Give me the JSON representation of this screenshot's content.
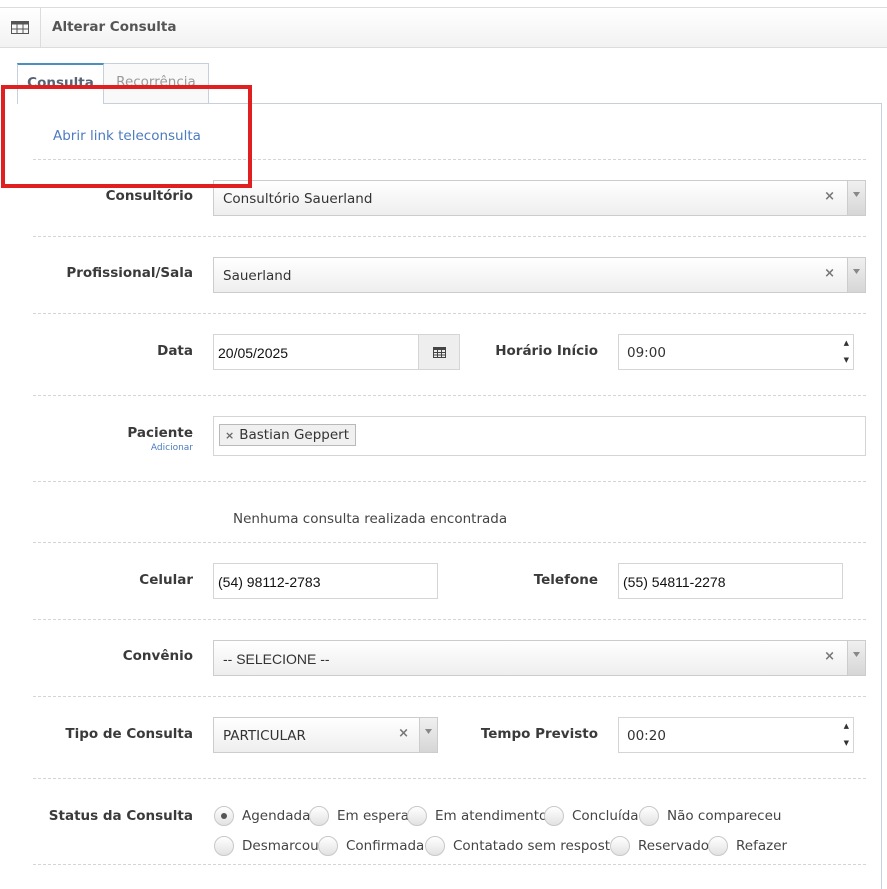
{
  "header": {
    "title": "Alterar Consulta",
    "icon": "table-icon"
  },
  "tabs": [
    {
      "label": "Consulta",
      "active": true
    },
    {
      "label": "Recorrência",
      "active": false
    }
  ],
  "teleconsulta_link": "Abrir link teleconsulta",
  "fields": {
    "consultorio": {
      "label": "Consultório",
      "value": "Consultório Sauerland",
      "clear": "×"
    },
    "profissional": {
      "label": "Profissional/Sala",
      "value": "Sauerland",
      "clear": "×"
    },
    "data": {
      "label": "Data",
      "value": "20/05/2025"
    },
    "horario_inicio": {
      "label": "Horário Início",
      "value": "09:00"
    },
    "paciente": {
      "label": "Paciente",
      "sublabel": "Adicionar",
      "tag": "Bastian Geppert",
      "tag_remove": "×"
    },
    "info_message": "Nenhuma consulta realizada encontrada",
    "celular": {
      "label": "Celular",
      "value": "(54) 98112-2783"
    },
    "telefone": {
      "label": "Telefone",
      "value": "(55) 54811-2278"
    },
    "convenio": {
      "label": "Convênio",
      "value": "-- SELECIONE --",
      "clear": "×"
    },
    "tipo_consulta": {
      "label": "Tipo de Consulta",
      "value": "PARTICULAR",
      "clear": "×"
    },
    "tempo_previsto": {
      "label": "Tempo Previsto",
      "value": "00:20"
    },
    "status": {
      "label": "Status da Consulta",
      "selected": "Agendada",
      "options": [
        "Agendada",
        "Em espera",
        "Em atendimento",
        "Concluída",
        "Não compareceu",
        "Desmarcou",
        "Confirmada",
        "Contatado sem resposta",
        "Reservado",
        "Refazer"
      ]
    }
  },
  "colors": {
    "accent": "#4c8fbd",
    "link": "#4c7bbf",
    "highlight_box": "#e02020"
  }
}
